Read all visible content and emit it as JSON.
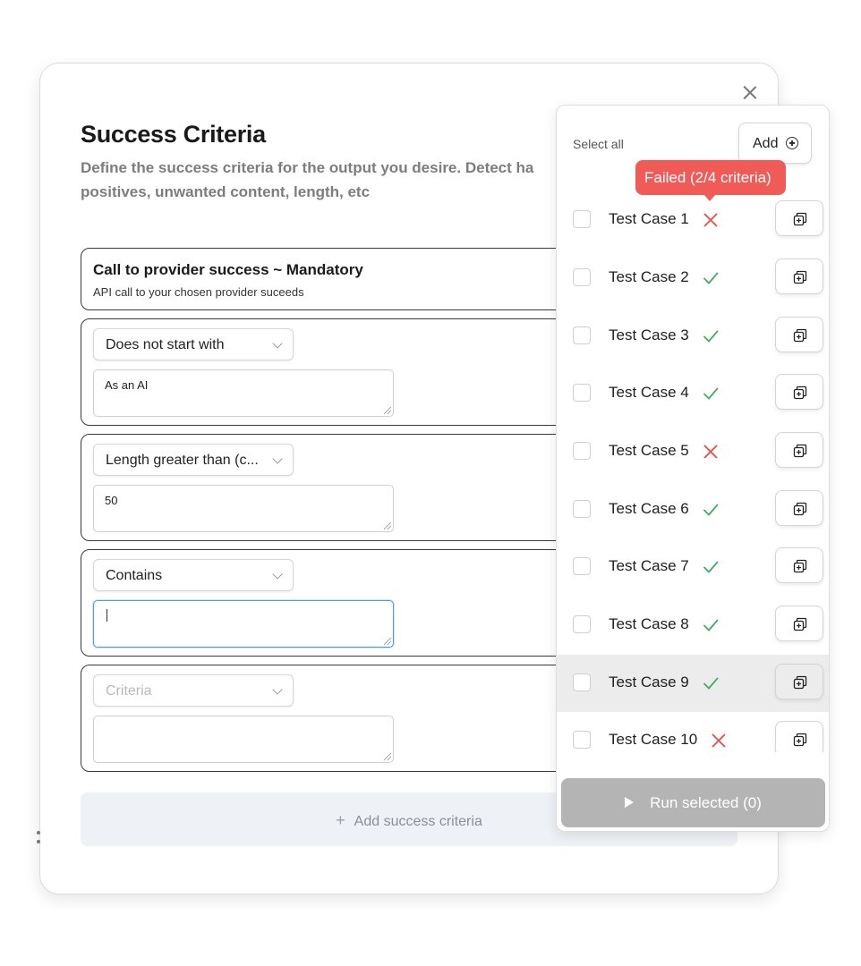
{
  "dialog": {
    "title": "Success Criteria",
    "description_line1": "Define the success criteria for the output you desire. Detect ha",
    "description_line2": "positives, unwanted content, length, etc"
  },
  "mandatory": {
    "title": "Call to provider success ~ Mandatory",
    "subtitle": "API call to your chosen provider suceeds"
  },
  "criteria": [
    {
      "type": "Does not start with",
      "value": "As an AI"
    },
    {
      "type": "Length greater than (c...",
      "value": "50"
    },
    {
      "type": "Contains",
      "value": ""
    },
    {
      "type_placeholder": "Criteria",
      "value": ""
    }
  ],
  "add_criteria_label": "Add success criteria",
  "panel": {
    "select_all": "Select all",
    "add_label": "Add",
    "tooltip": "Failed (2/4 criteria)",
    "run_label": "Run selected (0)",
    "test_cases": [
      {
        "label": "Test Case 1",
        "status": "fail"
      },
      {
        "label": "Test Case 2",
        "status": "pass"
      },
      {
        "label": "Test Case 3",
        "status": "pass"
      },
      {
        "label": "Test Case 4",
        "status": "pass"
      },
      {
        "label": "Test Case 5",
        "status": "fail"
      },
      {
        "label": "Test Case 6",
        "status": "pass"
      },
      {
        "label": "Test Case 7",
        "status": "pass"
      },
      {
        "label": "Test Case 8",
        "status": "pass"
      },
      {
        "label": "Test Case 9",
        "status": "pass"
      },
      {
        "label": "Test Case 10",
        "status": "fail"
      }
    ]
  },
  "colors": {
    "pass": "#3fae62",
    "fail": "#ee4b48",
    "focus": "#4d9be6",
    "tooltip": "#f15b57",
    "run_disabled": "#b4b4b4"
  },
  "icons": {
    "close": "close-icon",
    "add": "plus-circle-icon",
    "duplicate": "duplicate-icon",
    "pass": "check-icon",
    "fail": "cross-icon",
    "run": "play-icon",
    "dropdown": "chevron-down-icon"
  }
}
